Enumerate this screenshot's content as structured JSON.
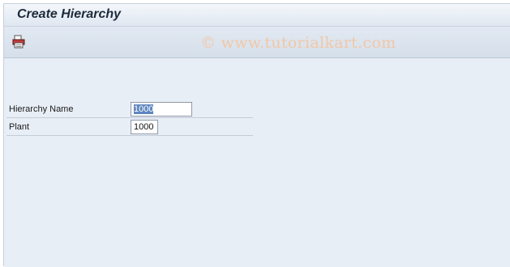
{
  "window": {
    "title": "Create Hierarchy"
  },
  "toolbar": {
    "watermark": "© www.tutorialkart.com",
    "print_icon": "printer-icon"
  },
  "form": {
    "hierarchy_name": {
      "label": "Hierarchy Name",
      "value": "1000"
    },
    "plant": {
      "label": "Plant",
      "value": "1000"
    }
  },
  "colors": {
    "background": "#e8eef6",
    "title_text": "#1c2a3a",
    "selection": "#5f86bf",
    "watermark": "#f2c7a6"
  }
}
